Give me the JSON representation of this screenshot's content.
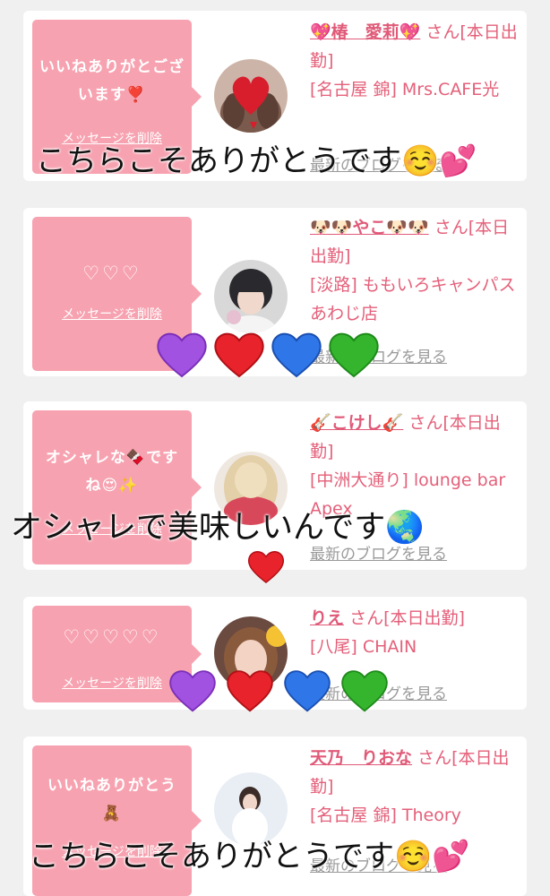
{
  "cards": [
    {
      "bubble": "いいねありがとございます❣️",
      "delete_label": "メッセージを削除",
      "name": "💖椿　愛莉💖",
      "suffix": "さん[本日出勤]",
      "shop": "[名古屋 錦] Mrs.CAFE光",
      "blog": "最新のブログを見る",
      "overlay_text": "こちらこそありがとうです☺️💕"
    },
    {
      "bubble": "♡♡♡",
      "delete_label": "メッセージを削除",
      "name": "🐶🐶やこ🐶🐶",
      "suffix": "さん[本日出勤]",
      "shop": "[淡路] ももいろキャンパス あわじ店",
      "blog": "最新のブログを見る",
      "overlay_hearts": [
        "purple",
        "red",
        "blue",
        "green"
      ]
    },
    {
      "bubble": "オシャレな🍫ですね😍✨",
      "delete_label": "メッセージを削除",
      "name": "🎸こけし🎸",
      "suffix": "さん[本日出勤]",
      "shop": "[中洲大通り] lounge bar Apex",
      "blog": "最新のブログを見る",
      "overlay_text": "オシャレで美味しいんです🌏",
      "overlay_extra": "❤️"
    },
    {
      "bubble": "♡♡♡♡♡",
      "delete_label": "メッセージを削除",
      "name": "りえ",
      "suffix": "さん[本日出勤]",
      "shop": "[八尾] CHAIN",
      "blog": "最新のブログを見る",
      "overlay_hearts": [
        "purple",
        "red",
        "blue",
        "green"
      ]
    },
    {
      "bubble": "いいねありがとう🧸",
      "delete_label": "メッセージを削除",
      "name": "天乃　りおな",
      "suffix": "さん[本日出勤]",
      "shop": "[名古屋 錦] Theory",
      "blog": "最新のブログを見る",
      "overlay_text": "こちらこそありがとうです☺️💕"
    }
  ],
  "colors": {
    "bubble": "#f7a2b0",
    "accent": "#e05a78",
    "heart_purple": "#a152e0",
    "heart_red": "#e8232b",
    "heart_blue": "#2f76e8",
    "heart_green": "#35b52d"
  }
}
